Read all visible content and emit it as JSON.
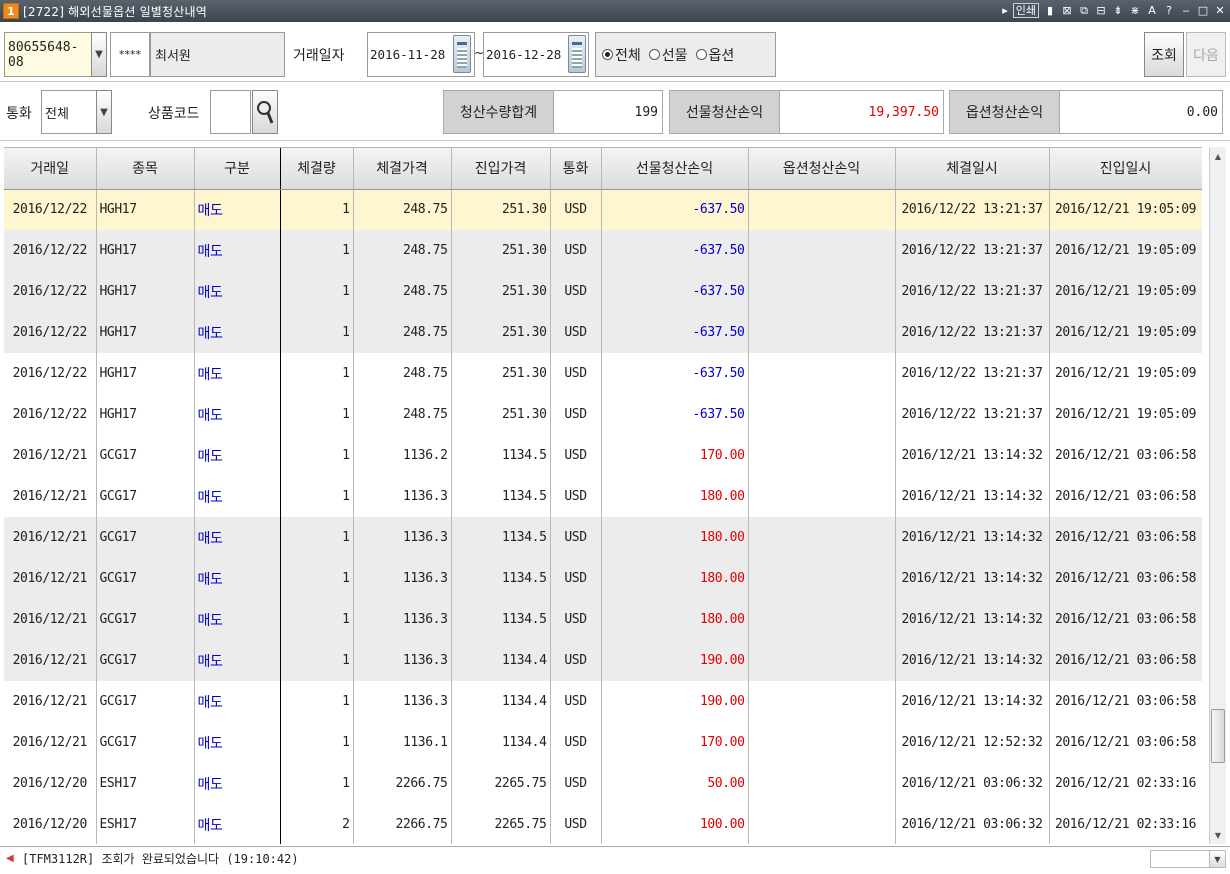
{
  "window": {
    "logo": "1",
    "title": "[2722] 해외선물옵션 일별청산내역",
    "print_label": "인쇄",
    "controls": [
      "▮",
      "⊠",
      "⧉",
      "⊟",
      "⇟",
      "⋇",
      "A",
      "?",
      "‒",
      "□",
      "✕"
    ]
  },
  "filters": {
    "account": "80655648-08",
    "password": "****",
    "account_name": "최서원",
    "trade_date_label": "거래일자",
    "date_from": "2016-11-28",
    "date_sep": "~",
    "date_to": "2016-12-28",
    "radio_options": [
      {
        "label": "전체",
        "selected": true
      },
      {
        "label": "선물",
        "selected": false
      },
      {
        "label": "옵션",
        "selected": false
      }
    ],
    "query_button": "조회",
    "next_button": "다음",
    "currency_label": "통화",
    "currency_value": "전체",
    "product_code_label": "상품코드",
    "product_code_value": ""
  },
  "summary": {
    "qty_label": "청산수량합계",
    "qty_value": "199",
    "futures_pl_label": "선물청산손익",
    "futures_pl_value": "19,397.50",
    "options_pl_label": "옵션청산손익",
    "options_pl_value": "0.00"
  },
  "table": {
    "columns": [
      "거래일",
      "종목",
      "구분",
      "체결량",
      "체결가격",
      "진입가격",
      "통화",
      "선물청산손익",
      "옵션청산손익",
      "체결일시",
      "진입일시"
    ],
    "rows": [
      {
        "date": "2016/12/22",
        "symbol": "HGH17",
        "side": "매도",
        "qty": "1",
        "price": "248.75",
        "entry": "251.30",
        "ccy": "USD",
        "fpl": "-637.50",
        "opl": "",
        "exec_time": "2016/12/22 13:21:37",
        "entry_time": "2016/12/21 19:05:09"
      },
      {
        "date": "2016/12/22",
        "symbol": "HGH17",
        "side": "매도",
        "qty": "1",
        "price": "248.75",
        "entry": "251.30",
        "ccy": "USD",
        "fpl": "-637.50",
        "opl": "",
        "exec_time": "2016/12/22 13:21:37",
        "entry_time": "2016/12/21 19:05:09"
      },
      {
        "date": "2016/12/22",
        "symbol": "HGH17",
        "side": "매도",
        "qty": "1",
        "price": "248.75",
        "entry": "251.30",
        "ccy": "USD",
        "fpl": "-637.50",
        "opl": "",
        "exec_time": "2016/12/22 13:21:37",
        "entry_time": "2016/12/21 19:05:09"
      },
      {
        "date": "2016/12/22",
        "symbol": "HGH17",
        "side": "매도",
        "qty": "1",
        "price": "248.75",
        "entry": "251.30",
        "ccy": "USD",
        "fpl": "-637.50",
        "opl": "",
        "exec_time": "2016/12/22 13:21:37",
        "entry_time": "2016/12/21 19:05:09"
      },
      {
        "date": "2016/12/22",
        "symbol": "HGH17",
        "side": "매도",
        "qty": "1",
        "price": "248.75",
        "entry": "251.30",
        "ccy": "USD",
        "fpl": "-637.50",
        "opl": "",
        "exec_time": "2016/12/22 13:21:37",
        "entry_time": "2016/12/21 19:05:09"
      },
      {
        "date": "2016/12/22",
        "symbol": "HGH17",
        "side": "매도",
        "qty": "1",
        "price": "248.75",
        "entry": "251.30",
        "ccy": "USD",
        "fpl": "-637.50",
        "opl": "",
        "exec_time": "2016/12/22 13:21:37",
        "entry_time": "2016/12/21 19:05:09"
      },
      {
        "date": "2016/12/21",
        "symbol": "GCG17",
        "side": "매도",
        "qty": "1",
        "price": "1136.2",
        "entry": "1134.5",
        "ccy": "USD",
        "fpl": "170.00",
        "opl": "",
        "exec_time": "2016/12/21 13:14:32",
        "entry_time": "2016/12/21 03:06:58"
      },
      {
        "date": "2016/12/21",
        "symbol": "GCG17",
        "side": "매도",
        "qty": "1",
        "price": "1136.3",
        "entry": "1134.5",
        "ccy": "USD",
        "fpl": "180.00",
        "opl": "",
        "exec_time": "2016/12/21 13:14:32",
        "entry_time": "2016/12/21 03:06:58"
      },
      {
        "date": "2016/12/21",
        "symbol": "GCG17",
        "side": "매도",
        "qty": "1",
        "price": "1136.3",
        "entry": "1134.5",
        "ccy": "USD",
        "fpl": "180.00",
        "opl": "",
        "exec_time": "2016/12/21 13:14:32",
        "entry_time": "2016/12/21 03:06:58"
      },
      {
        "date": "2016/12/21",
        "symbol": "GCG17",
        "side": "매도",
        "qty": "1",
        "price": "1136.3",
        "entry": "1134.5",
        "ccy": "USD",
        "fpl": "180.00",
        "opl": "",
        "exec_time": "2016/12/21 13:14:32",
        "entry_time": "2016/12/21 03:06:58"
      },
      {
        "date": "2016/12/21",
        "symbol": "GCG17",
        "side": "매도",
        "qty": "1",
        "price": "1136.3",
        "entry": "1134.5",
        "ccy": "USD",
        "fpl": "180.00",
        "opl": "",
        "exec_time": "2016/12/21 13:14:32",
        "entry_time": "2016/12/21 03:06:58"
      },
      {
        "date": "2016/12/21",
        "symbol": "GCG17",
        "side": "매도",
        "qty": "1",
        "price": "1136.3",
        "entry": "1134.4",
        "ccy": "USD",
        "fpl": "190.00",
        "opl": "",
        "exec_time": "2016/12/21 13:14:32",
        "entry_time": "2016/12/21 03:06:58"
      },
      {
        "date": "2016/12/21",
        "symbol": "GCG17",
        "side": "매도",
        "qty": "1",
        "price": "1136.3",
        "entry": "1134.4",
        "ccy": "USD",
        "fpl": "190.00",
        "opl": "",
        "exec_time": "2016/12/21 13:14:32",
        "entry_time": "2016/12/21 03:06:58"
      },
      {
        "date": "2016/12/21",
        "symbol": "GCG17",
        "side": "매도",
        "qty": "1",
        "price": "1136.1",
        "entry": "1134.4",
        "ccy": "USD",
        "fpl": "170.00",
        "opl": "",
        "exec_time": "2016/12/21 12:52:32",
        "entry_time": "2016/12/21 03:06:58"
      },
      {
        "date": "2016/12/20",
        "symbol": "ESH17",
        "side": "매도",
        "qty": "1",
        "price": "2266.75",
        "entry": "2265.75",
        "ccy": "USD",
        "fpl": "50.00",
        "opl": "",
        "exec_time": "2016/12/21 03:06:32",
        "entry_time": "2016/12/21 02:33:16"
      },
      {
        "date": "2016/12/20",
        "symbol": "ESH17",
        "side": "매도",
        "qty": "2",
        "price": "2266.75",
        "entry": "2265.75",
        "ccy": "USD",
        "fpl": "100.00",
        "opl": "",
        "exec_time": "2016/12/21 03:06:32",
        "entry_time": "2016/12/21 02:33:16"
      }
    ]
  },
  "status": {
    "message": "[TFM3112R] 조회가 완료되었습니다 (19:10:42)"
  },
  "colors": {
    "sell": "#0000c8",
    "profit": "#e00000",
    "loss": "#0000c8",
    "selected_row": "#fff5cf"
  }
}
